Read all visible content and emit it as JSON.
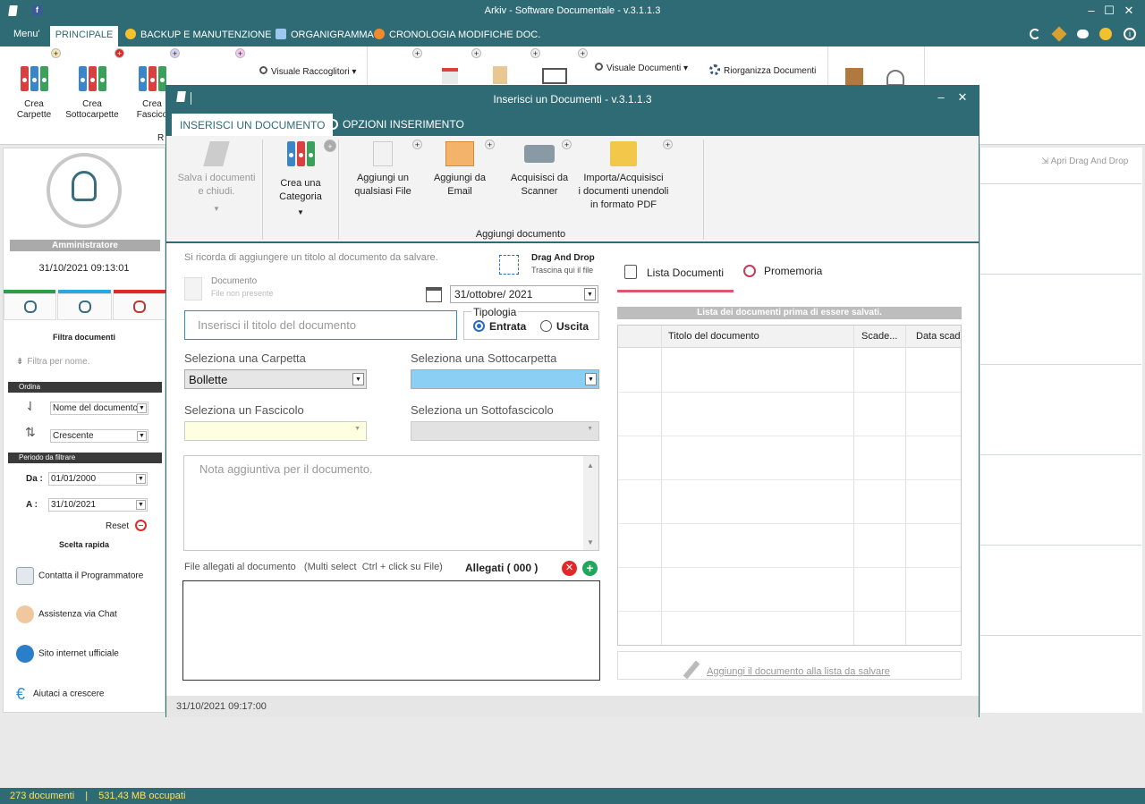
{
  "app": {
    "title": "Arkiv - Software Documentale - v.3.1.1.3",
    "status_docs": "273 documenti",
    "status_sep": "|",
    "status_size": "531,43 MB occupati"
  },
  "menu": {
    "menu_label": "Menu'",
    "principale": "PRINCIPALE",
    "backup": "BACKUP E MANUTENZIONE",
    "organigramma": "ORGANIGRAMMA",
    "cronologia": "CRONOLOGIA MODIFICHE DOC."
  },
  "toolbar": {
    "crea_carpette": "Crea\nCarpette",
    "crea_sottocarpette": "Crea\nSottocarpette",
    "crea_fascicoli": "Crea\nFascico",
    "visuale_raccoglitori": "Visuale Raccoglitori",
    "visuale_documenti": "Visuale Documenti",
    "riorganizza_documenti": "Riorganizza Documenti",
    "group_r": "R"
  },
  "left": {
    "user": "Amministratore",
    "datetime": "31/10/2021 09:13:01",
    "filtra_documenti": "Filtra documenti",
    "filtra_placeholder": "Filtra per nome.",
    "ordina": "Ordina",
    "order_by": "Nome del documento",
    "order_dir": "Crescente",
    "periodo": "Periodo da filtrare",
    "da_label": "Da :",
    "da_value": "01/01/2000",
    "a_label": "A :",
    "a_value": "31/10/2021",
    "reset": "Reset",
    "scelta_rapida": "Scelta rapida",
    "contatta": "Contatta il Programmatore",
    "assistenza": "Assistenza via Chat",
    "sito": "Sito internet ufficiale",
    "aiutaci": "Aiutaci a crescere"
  },
  "right_bg": {
    "apri_drag": "Apri Drag And Drop"
  },
  "dialog": {
    "title": "Inserisci un Documenti - v.3.1.1.3",
    "tab_inserisci": "INSERISCI UN DOCUMENTO",
    "tab_opzioni": "OPZIONI INSERIMENTO",
    "ribbon": {
      "salva": "Salva i documenti\ne chiudi.",
      "crea_categoria": "Crea una\nCategoria",
      "aggiungi_file": "Aggiungi un\nqualsiasi File",
      "aggiungi_email": "Aggiungi da\nEmail",
      "acquisisci_scanner": "Acquisisci da\nScanner",
      "importa": "Importa/Acquisisci\ni documenti unendoli\nin formato PDF",
      "group_label": "Aggiungi documento"
    },
    "form": {
      "reminder": "Si ricorda di aggiungere un titolo al documento da salvare.",
      "drag_title": "Drag And Drop",
      "drag_sub": "Trascina qui il file",
      "documento_label": "Documento",
      "documento_sub": "File non presente",
      "date_value": "31/ottobre/ 2021",
      "titolo_placeholder": "Inserisci il titolo del documento",
      "tipologia": "Tipologia",
      "entrata": "Entrata",
      "uscita": "Uscita",
      "carpetta_label": "Seleziona una Carpetta",
      "carpetta_value": "Bollette",
      "sottocarpetta_label": "Seleziona una Sottocarpetta",
      "fascicolo_label": "Seleziona un Fascicolo",
      "sottofascicolo_label": "Seleziona un Sottofascicolo",
      "nota_placeholder": "Nota aggiuntiva per il documento.",
      "allegati_hint": "File allegati al documento   (Multi select  Ctrl + click su File)",
      "allegati_count": "Allegati ( 000 )"
    },
    "list": {
      "tab_lista": "Lista Documenti",
      "tab_promemoria": "Promemoria",
      "header_bar": "Lista dei documenti prima di essere salvati.",
      "col_titolo": "Titolo del documento",
      "col_scade": "Scade...",
      "col_data": "Data scade",
      "add_button": "Aggiungi il documento alla lista da salvare"
    },
    "footer_datetime": "31/10/2021 09:17:00"
  },
  "colors": {
    "brand": "#2f6b74",
    "status_text": "#ffe15a",
    "accent_pink": "#e0566e",
    "green_bar": "#2e9e46",
    "blue_bar": "#29a8e0",
    "red_bar": "#e02a2a"
  }
}
